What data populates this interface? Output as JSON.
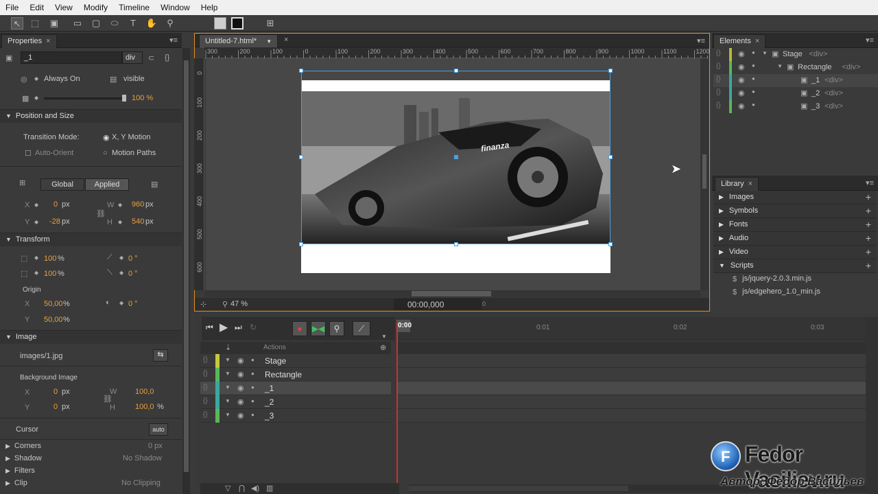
{
  "menu": [
    "File",
    "Edit",
    "View",
    "Modify",
    "Timeline",
    "Window",
    "Help"
  ],
  "properties": {
    "tab": "Properties",
    "element_id": "_1",
    "element_type": "div",
    "display": "Always On",
    "overflow": "visible",
    "opacity": "100 %",
    "position_size": {
      "header": "Position and Size",
      "transition_mode_label": "Transition Mode:",
      "xy_motion": "X, Y Motion",
      "auto_orient": "Auto-Orient",
      "motion_paths": "Motion Paths",
      "global": "Global",
      "applied": "Applied",
      "x": "0",
      "y": "-28",
      "w": "960",
      "h": "540",
      "unit": "px",
      "x_label": "X",
      "y_label": "Y",
      "w_label": "W",
      "h_label": "H"
    },
    "transform": {
      "header": "Transform",
      "scale_x": "100",
      "scale_y": "100",
      "pct": "%",
      "skew_x": "0 °",
      "skew_y": "0 °",
      "origin_label": "Origin",
      "origin_x": "50,00",
      "origin_y": "50,00",
      "rotation": "0 °"
    },
    "image": {
      "header": "Image",
      "source": "images/1.jpg",
      "bg_label": "Background Image",
      "x": "0",
      "y": "0",
      "w": "100,0",
      "h": "100,0",
      "unit": "px",
      "pct": "%"
    },
    "cursor": {
      "label": "Cursor",
      "value": "auto"
    },
    "corners": {
      "label": "Corners",
      "value": "0 px"
    },
    "shadow": {
      "label": "Shadow",
      "value": "No Shadow"
    },
    "filters": {
      "label": "Filters"
    },
    "clip": {
      "label": "Clip",
      "value": "No Clipping"
    }
  },
  "stage": {
    "tab": "Untitled-7.html*",
    "ruler_top": [
      "300",
      "200",
      "100",
      "0",
      "100",
      "200",
      "300",
      "400",
      "500",
      "600",
      "700",
      "800",
      "900",
      "1000",
      "1100",
      "1200"
    ],
    "ruler_left": [
      "0",
      "100",
      "200",
      "300",
      "400",
      "500",
      "600"
    ],
    "zoom": "47 %",
    "time": "00:00,000",
    "time_small": "0",
    "car_text": "finanza"
  },
  "timeline": {
    "current": "0:00",
    "marks": [
      "0:01",
      "0:02",
      "0:03"
    ],
    "actions": "Actions",
    "rows": [
      "Stage",
      "Rectangle",
      "_1",
      "_2",
      "_3"
    ]
  },
  "elements": {
    "tab": "Elements",
    "items": [
      {
        "name": "Stage",
        "tag": "<div>"
      },
      {
        "name": "Rectangle",
        "tag": "<div>"
      },
      {
        "name": "_1",
        "tag": "<div>"
      },
      {
        "name": "_2",
        "tag": "<div>"
      },
      {
        "name": "_3",
        "tag": "<div>"
      }
    ]
  },
  "library": {
    "tab": "Library",
    "sections": [
      "Images",
      "Symbols",
      "Fonts",
      "Audio",
      "Video",
      "Scripts"
    ],
    "scripts": [
      "js/jquery-2.0.3.min.js",
      "js/edgehero_1.0_min.js"
    ]
  },
  "watermark": {
    "title": "Fedor Vasiliev.ru",
    "author": "Автор: Федор Васильев"
  },
  "colors": {
    "accent_orange": "#e89020",
    "selection_blue": "#4aa0e0",
    "playhead_red": "#d03030"
  }
}
